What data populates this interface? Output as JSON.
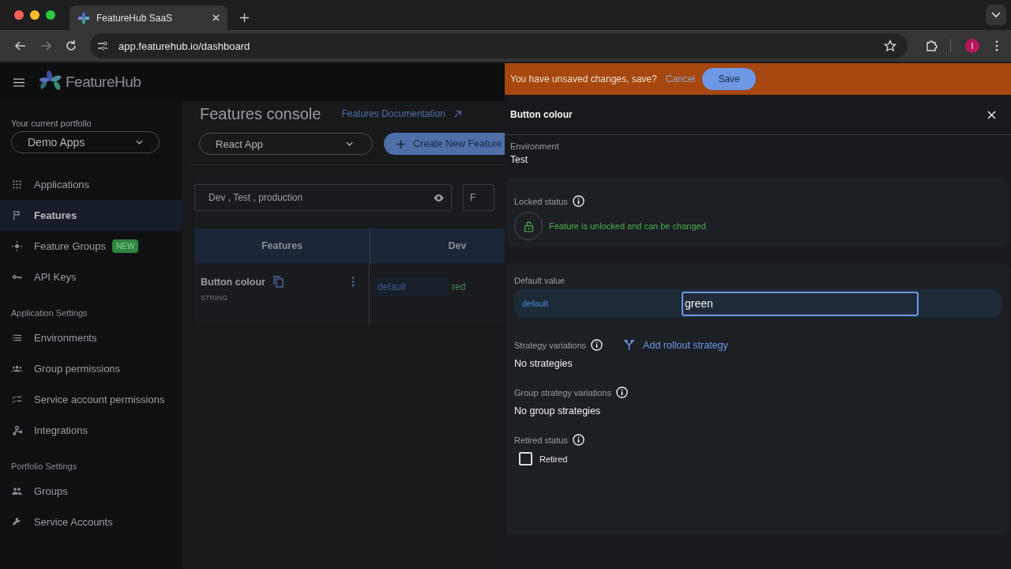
{
  "browser": {
    "tab_title": "FeatureHub SaaS",
    "url": "app.featurehub.io/dashboard",
    "avatar": "I"
  },
  "app": {
    "brand": "FeatureHub"
  },
  "sidebar": {
    "portfolio_label": "Your current portfolio",
    "portfolio": "Demo Apps",
    "sections": [
      {
        "items": [
          {
            "label": "Applications",
            "selected": false
          },
          {
            "label": "Features",
            "selected": true
          },
          {
            "label": "Feature Groups",
            "selected": false,
            "badge": "NEW"
          },
          {
            "label": "API Keys",
            "selected": false
          }
        ]
      },
      {
        "heading": "Application Settings",
        "items": [
          {
            "label": "Environments",
            "selected": false
          },
          {
            "label": "Group permissions",
            "selected": false
          },
          {
            "label": "Service account permissions",
            "selected": false
          },
          {
            "label": "Integrations",
            "selected": false
          }
        ]
      },
      {
        "heading": "Portfolio Settings",
        "items": [
          {
            "label": "Groups",
            "selected": false
          },
          {
            "label": "Service Accounts",
            "selected": false
          }
        ]
      }
    ]
  },
  "main": {
    "title": "Features console",
    "docs_link": "Features Documentation",
    "application": "React App",
    "create_button": "Create New Feature",
    "environments_filter": "Dev , Test , production",
    "filter_2": "F",
    "table": {
      "columns": [
        "Features",
        "Dev"
      ],
      "rows": [
        {
          "name": "Button colour",
          "type": "STRING",
          "dev_label": "default",
          "dev_value": "red"
        }
      ]
    }
  },
  "drawer": {
    "banner": {
      "message": "You have unsaved changes, save?",
      "cancel": "Cancel",
      "save": "Save"
    },
    "title": "Button colour",
    "environment_label": "Environment",
    "environment": "Test",
    "locked_label": "Locked status",
    "locked": false,
    "locked_text": "Feature is unlocked and can be changed",
    "default_label": "Default value",
    "default_key": "default",
    "default_value": "green",
    "strategy_label": "Strategy variations",
    "add_strategy": "Add rollout strategy",
    "strategies_text": "No strategies",
    "group_label": "Group strategy variations",
    "group_text": "No group strategies",
    "retired_label": "Retired status",
    "retired_text": "Retired",
    "retired": false
  }
}
